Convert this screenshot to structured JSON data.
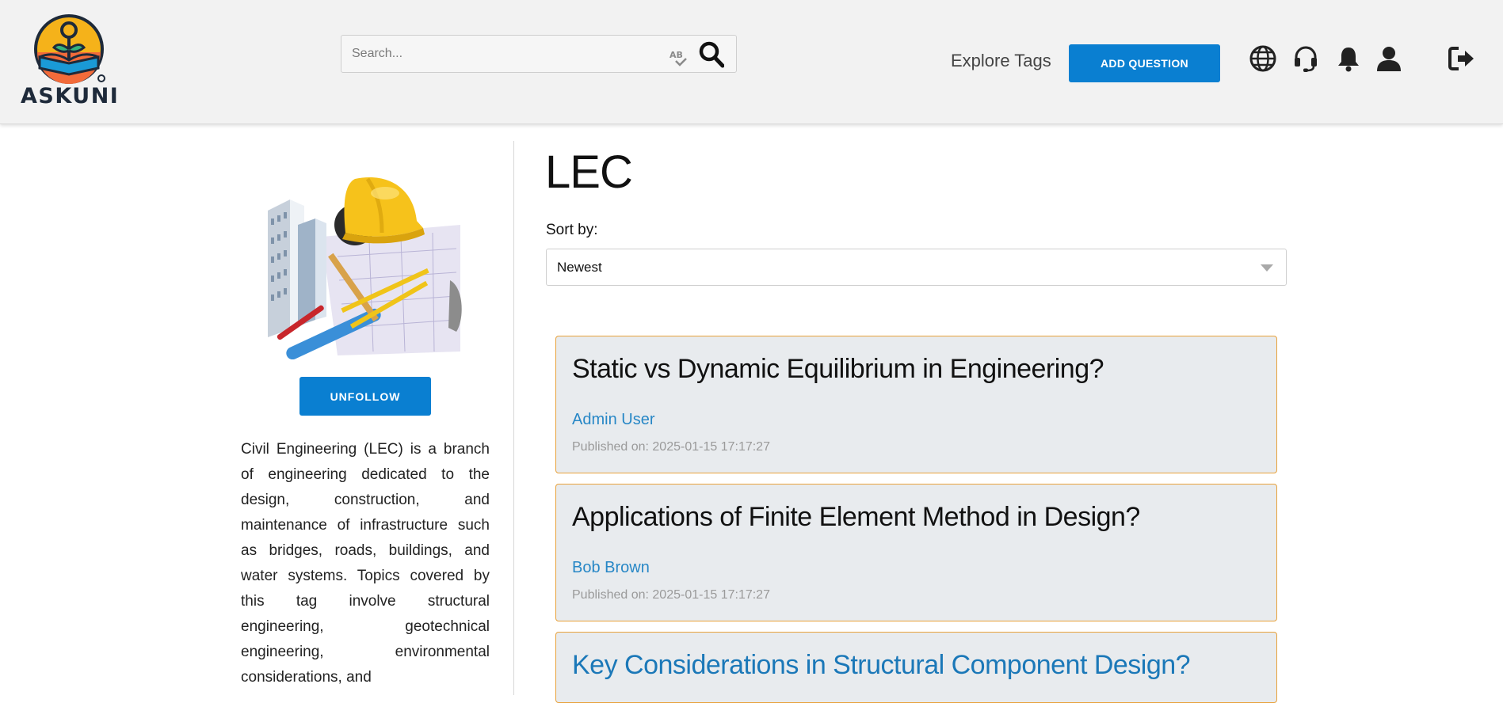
{
  "header": {
    "logo_text": "ASKUNI",
    "search": {
      "placeholder": "Search...",
      "value": ""
    },
    "explore_label": "Explore Tags",
    "add_question_label": "ADD QUESTION",
    "icons": [
      "globe-icon",
      "headset-icon",
      "bell-icon",
      "user-icon",
      "logout-icon"
    ]
  },
  "sidebar": {
    "unfollow_label": "UNFOLLOW",
    "description": "Civil Engineering (LEC) is a branch of engineering dedicated to the design, construction, and maintenance of infrastructure such as bridges, roads, buildings, and water systems. Topics covered by this tag involve structural engineering, geotechnical engineering, environmental considerations, and"
  },
  "main": {
    "tag_title": "LEC",
    "sort_label": "Sort by:",
    "sort_value": "Newest",
    "questions": [
      {
        "title": "Static vs Dynamic Equilibrium in Engineering?",
        "author": "Admin User",
        "published": "Published on: 2025-01-15 17:17:27"
      },
      {
        "title": "Applications of Finite Element Method in Design?",
        "author": "Bob Brown",
        "published": "Published on: 2025-01-15 17:17:27"
      },
      {
        "title": "Key Considerations in Structural Component Design?"
      }
    ]
  },
  "colors": {
    "primary_button": "#0a7fd1",
    "card_background": "#e8ebee",
    "card_border": "#e8a13a",
    "author_link": "#2787c6",
    "header_background": "#f2f2f2"
  }
}
